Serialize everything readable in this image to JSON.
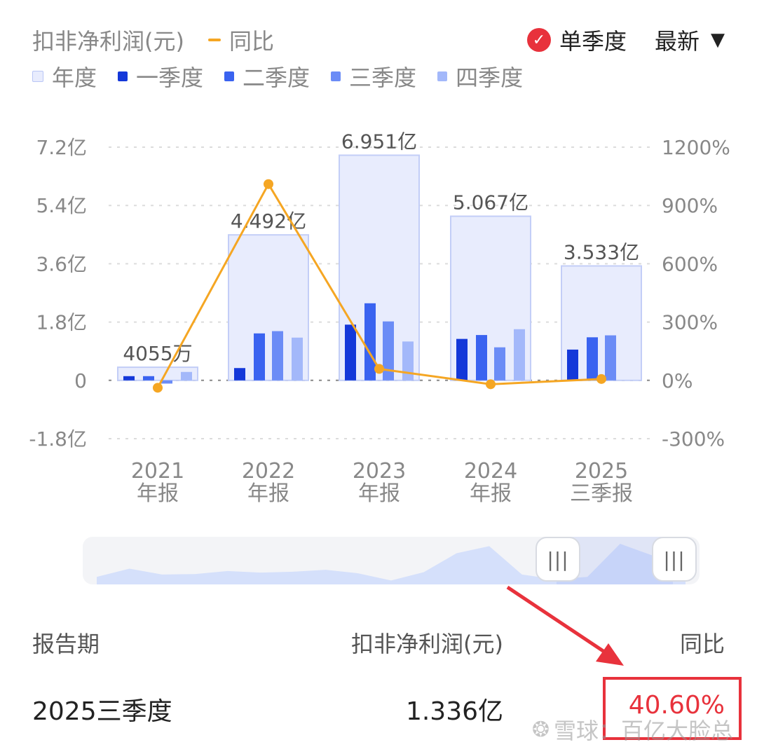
{
  "legend": {
    "metric": "扣非净利润(元)",
    "yoy": "同比",
    "items": [
      {
        "label": "年度",
        "color": "#e8ecfd"
      },
      {
        "label": "一季度",
        "color": "#1438d9"
      },
      {
        "label": "二季度",
        "color": "#3a63f0"
      },
      {
        "label": "三季度",
        "color": "#6b8cf6"
      },
      {
        "label": "四季度",
        "color": "#a3b8fa"
      }
    ]
  },
  "controls": {
    "mode_label": "单季度",
    "sort_label": "最新",
    "check_icon": "check-circle-icon",
    "dropdown_icon": "triangle-down-icon"
  },
  "chart_data": {
    "type": "bar",
    "categories": [
      [
        "2021",
        "年报"
      ],
      [
        "2022",
        "年报"
      ],
      [
        "2023",
        "年报"
      ],
      [
        "2024",
        "年报"
      ],
      [
        "2025",
        "三季报"
      ]
    ],
    "annual_values": [
      0.4055,
      4.492,
      6.951,
      5.067,
      3.533
    ],
    "annual_labels": [
      "4055万",
      "4.492亿",
      "6.951亿",
      "5.067亿",
      "3.533亿"
    ],
    "series": [
      {
        "name": "一季度",
        "values": [
          0.13,
          0.38,
          1.72,
          1.28,
          0.95
        ]
      },
      {
        "name": "二季度",
        "values": [
          0.13,
          1.45,
          2.38,
          1.4,
          1.33
        ]
      },
      {
        "name": "三季度",
        "values": [
          -0.1,
          1.52,
          1.82,
          1.02,
          1.39
        ]
      },
      {
        "name": "四季度",
        "values": [
          0.26,
          1.32,
          1.2,
          1.58,
          null
        ]
      }
    ],
    "yoy": {
      "name": "同比",
      "values": [
        -38,
        1010,
        59,
        -20,
        7
      ]
    },
    "ylim": [
      -1.8,
      7.2
    ],
    "yticks": [
      -1.8,
      0,
      1.8,
      3.6,
      5.4,
      7.2
    ],
    "ytick_labels": [
      "-1.8亿",
      "0",
      "1.8亿",
      "3.6亿",
      "5.4亿",
      "7.2亿"
    ],
    "y2lim": [
      -300,
      1200
    ],
    "y2ticks": [
      -300,
      0,
      300,
      600,
      900,
      1200
    ],
    "y2tick_labels": [
      "-300%",
      "0%",
      "300%",
      "600%",
      "900%",
      "1200%"
    ],
    "grid": true,
    "colors": {
      "annual_fill": "#e8ecfd",
      "annual_stroke": "#c3cef7",
      "line": "#f5a623",
      "grid": "#dcdcdc",
      "axis_text": "#888888"
    }
  },
  "overview": {
    "values": [
      0.2,
      0.55,
      0.3,
      0.32,
      0.45,
      0.38,
      0.42,
      0.5,
      0.35,
      0.05,
      0.4,
      1.2,
      1.5,
      0.3,
      0.1,
      0.2,
      1.6,
      1.1,
      0.7
    ],
    "color": "#d5e0fb"
  },
  "table": {
    "headers": {
      "period": "报告期",
      "metric": "扣非净利润(元)",
      "yoy": "同比"
    },
    "row": {
      "period": "2025三季度",
      "metric": "1.336亿",
      "yoy": "40.60%"
    },
    "yoy_color": "#e8323c"
  },
  "annotation": {
    "arrow_color": "#e8323c"
  },
  "watermark": {
    "text": "雪球：百亿大脸总"
  }
}
